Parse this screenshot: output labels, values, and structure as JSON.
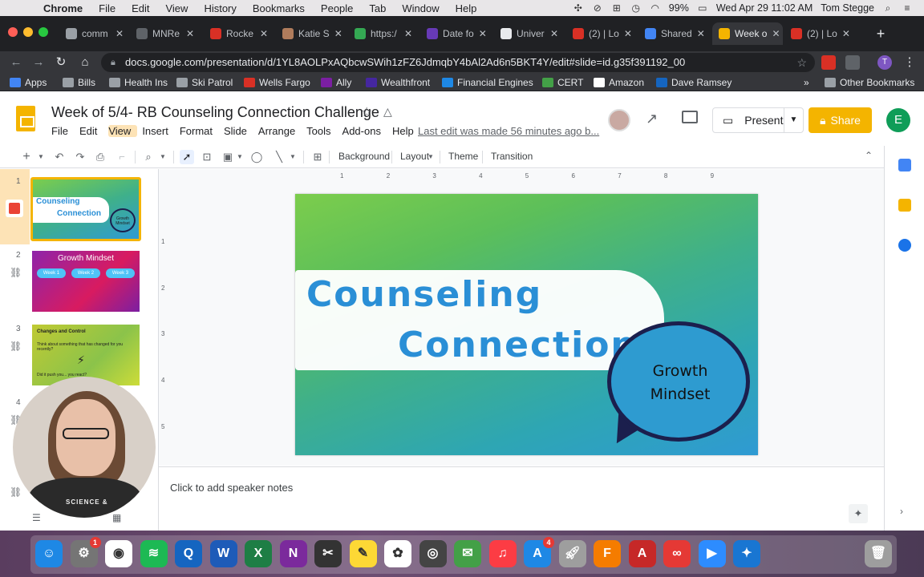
{
  "menubar": {
    "app": "Chrome",
    "items": [
      "File",
      "Edit",
      "View",
      "History",
      "Bookmarks",
      "People",
      "Tab",
      "Window",
      "Help"
    ],
    "battery": "99%",
    "clock": "Wed Apr 29  11:02 AM",
    "user": "Tom Stegge"
  },
  "tabs": [
    {
      "label": "comm",
      "color": "#9aa0a6"
    },
    {
      "label": "MNRe",
      "color": "#5f6368"
    },
    {
      "label": "Rocke",
      "color": "#d93025"
    },
    {
      "label": "Katie S",
      "color": "#b07c5c"
    },
    {
      "label": "https:/",
      "color": "#34a853"
    },
    {
      "label": "Date fo",
      "color": "#673ab7"
    },
    {
      "label": "Univer",
      "color": "#e8eaed"
    },
    {
      "label": "(2) | Lo",
      "color": "#d93025"
    },
    {
      "label": "Shared",
      "color": "#4285f4"
    },
    {
      "label": "Week o",
      "color": "#f4b400"
    },
    {
      "label": "(2) | Lo",
      "color": "#d93025"
    }
  ],
  "address": {
    "url": "docs.google.com/presentation/d/1YL8AOLPxAQbcwSWih1zFZ6JdmqbY4bAl2Ad6n5BKT4Y/edit#slide=id.g35f391192_00"
  },
  "bookmarks": [
    {
      "label": "Apps",
      "color": "#4285f4"
    },
    {
      "label": "Bills",
      "color": "#9aa0a6"
    },
    {
      "label": "Health Ins",
      "color": "#9aa0a6"
    },
    {
      "label": "Ski Patrol",
      "color": "#9aa0a6"
    },
    {
      "label": "Wells Fargo",
      "color": "#d93025"
    },
    {
      "label": "Ally",
      "color": "#7b1fa2"
    },
    {
      "label": "Wealthfront",
      "color": "#4527a0"
    },
    {
      "label": "Financial Engines",
      "color": "#1e88e5"
    },
    {
      "label": "CERT",
      "color": "#43a047"
    },
    {
      "label": "Amazon",
      "color": "#ffffff"
    },
    {
      "label": "Dave Ramsey",
      "color": "#1565c0"
    }
  ],
  "bookmarks_more": "»",
  "other_bookmarks": "Other Bookmarks",
  "doc": {
    "title": "Week of 5/4- RB Counseling Connection Challenge",
    "menu": [
      "File",
      "Edit",
      "View",
      "Insert",
      "Format",
      "Slide",
      "Arrange",
      "Tools",
      "Add-ons",
      "Help"
    ],
    "last_edit": "Last edit was made 56 minutes ago b...",
    "present": "Present",
    "share": "Share",
    "user_initial": "E"
  },
  "toolbar": {
    "background": "Background",
    "layout": "Layout",
    "theme": "Theme",
    "transition": "Transition"
  },
  "ruler": {
    "h": [
      "1",
      "2",
      "3",
      "4",
      "5",
      "6",
      "7",
      "8",
      "9"
    ],
    "v": [
      "1",
      "2",
      "3",
      "4",
      "5"
    ]
  },
  "filmstrip": {
    "numbers": [
      "1",
      "2",
      "3",
      "4"
    ],
    "slide1": {
      "line1": "Counseling",
      "line2": "Connection",
      "bubble": "Growth Mindset"
    },
    "slide2": {
      "title": "Growth Mindset",
      "weeks": [
        "Week 1",
        "Week 2",
        "Week 3"
      ]
    },
    "slide3": {
      "title": "Changes and Control",
      "line1": "Think about something that has changed for you recently?",
      "line2": "Did it push you... you react?"
    }
  },
  "slide": {
    "line1": "Counseling",
    "line2": "Connection",
    "bubble_line1": "Growth",
    "bubble_line2": "Mindset"
  },
  "notes": {
    "placeholder": "Click to add speaker notes"
  },
  "webcam": {
    "shirt_text": "SCIENCE &"
  },
  "dock": {
    "apps": [
      "Finder",
      "System Preferences",
      "Chrome",
      "Spotify",
      "QuickTime",
      "Word",
      "Excel",
      "OneNote",
      "Final Cut",
      "Notes",
      "Photos",
      "Photo Booth",
      "Messages",
      "Music",
      "App Store",
      "Launchpad",
      "Fusion 360",
      "Acrobat",
      "Creative Cloud",
      "Zoom",
      "Safari"
    ],
    "badges": {
      "System Preferences": "1",
      "App Store": "4"
    }
  }
}
